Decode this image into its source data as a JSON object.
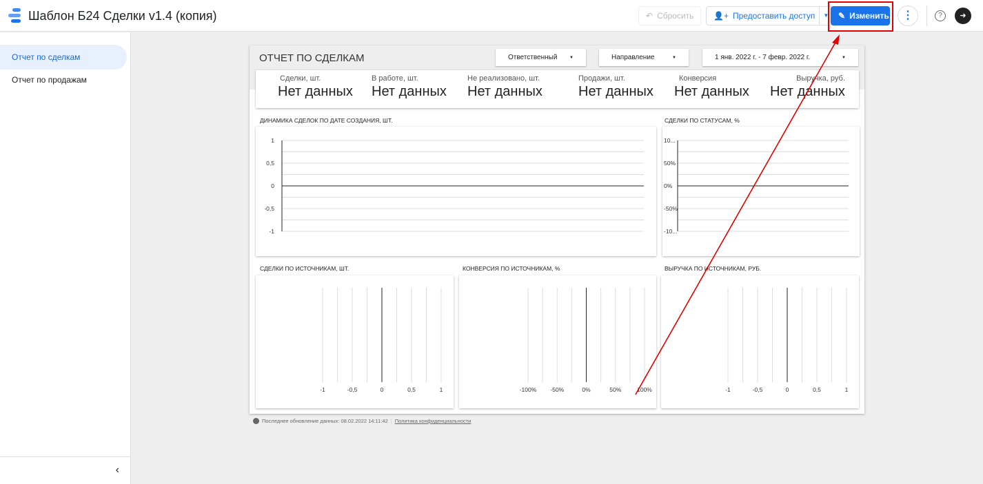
{
  "header": {
    "title": "Шаблон Б24 Сделки v1.4 (копия)",
    "reset": "Сбросить",
    "share": "Предоставить доступ",
    "edit": "Изменить"
  },
  "sidebar": {
    "items": [
      {
        "label": "Отчет по сделкам"
      },
      {
        "label": "Отчет по продажам"
      }
    ]
  },
  "report": {
    "title": "ОТЧЕТ ПО СДЕЛКАМ",
    "filters": {
      "owner": "Ответственный",
      "direction": "Направление",
      "date": "1 янв. 2022 г. - 7 февр. 2022 г."
    },
    "kpis": [
      {
        "label": "Сделки, шт.",
        "value": "Нет данных"
      },
      {
        "label": "В работе, шт.",
        "value": "Нет данных"
      },
      {
        "label": "Не реализовано, шт.",
        "value": "Нет данных"
      },
      {
        "label": "Продажи, шт.",
        "value": "Нет данных"
      },
      {
        "label": "Конверсия",
        "value": "Нет данных"
      },
      {
        "label": "Выручка, руб.",
        "value": "Нет данных"
      }
    ],
    "charts": {
      "dynamics": {
        "title": "ДИНАМИКА СДЕЛОК ПО ДАТЕ СОЗДАНИЯ, ШТ.",
        "ticks": [
          "1",
          "0,5",
          "0",
          "-0,5",
          "-1"
        ]
      },
      "statuses": {
        "title": "СДЕЛКИ ПО СТАТУСАМ, %",
        "ticks": [
          "10...",
          "50%",
          "0%",
          "-50%",
          "-10..."
        ]
      },
      "sources": {
        "title": "СДЕЛКИ ПО ИСТОЧНИКАМ, ШТ.",
        "ticks": [
          "-1",
          "-0,5",
          "0",
          "0,5",
          "1"
        ]
      },
      "conversion": {
        "title": "КОНВЕРСИЯ ПО ИСТОЧНИКАМ, %",
        "ticks": [
          "-100%",
          "-50%",
          "0%",
          "50%",
          "100%"
        ]
      },
      "revenue": {
        "title": "ВЫРУЧКА ПО ИСТОЧНИКАМ, РУБ.",
        "ticks": [
          "-1",
          "-0,5",
          "0",
          "0,5",
          "1"
        ]
      }
    }
  },
  "footer": {
    "updated": "Последнее обновление данных: 08.02.2022 14:11:42",
    "privacy": "Политика конфиденциальности"
  },
  "colors": {
    "accent": "#1a73e8",
    "annotation": "#e00000"
  }
}
